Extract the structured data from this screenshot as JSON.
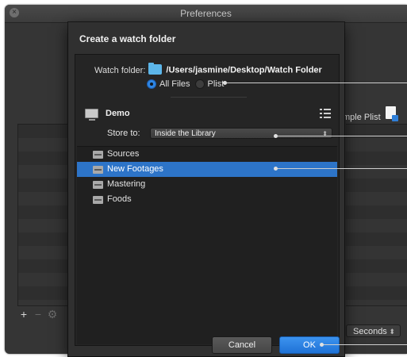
{
  "window": {
    "title": "Preferences"
  },
  "background": {
    "sample_plist_label": "mple Plist",
    "seconds_select": "Seconds",
    "list_controls": [
      "+",
      "−",
      "⚙"
    ]
  },
  "sheet": {
    "title": "Create a watch folder",
    "watch_folder_label": "Watch folder:",
    "watch_folder_path": "/Users/jasmine/Desktop/Watch Folder",
    "radio_options": [
      {
        "label": "All Files",
        "selected": true
      },
      {
        "label": "Plist",
        "selected": false
      }
    ],
    "library_name": "Demo",
    "store_to_label": "Store to:",
    "store_to_value": "Inside the Library",
    "folders": [
      {
        "label": "Sources",
        "selected": false
      },
      {
        "label": "New Footages",
        "selected": true
      },
      {
        "label": "Mastering",
        "selected": false
      },
      {
        "label": "Foods",
        "selected": false
      }
    ],
    "cancel_label": "Cancel",
    "ok_label": "OK"
  },
  "icons": {
    "close": "close-icon",
    "folder": "folder-icon",
    "library": "computer-icon",
    "list_view": "list-icon",
    "drawer": "drawer-icon",
    "document": "document-icon",
    "gear": "gear-icon"
  },
  "colors": {
    "accent": "#2d74c8",
    "folder_icon": "#5cb6ea",
    "ok_button": "#1f72d6"
  }
}
